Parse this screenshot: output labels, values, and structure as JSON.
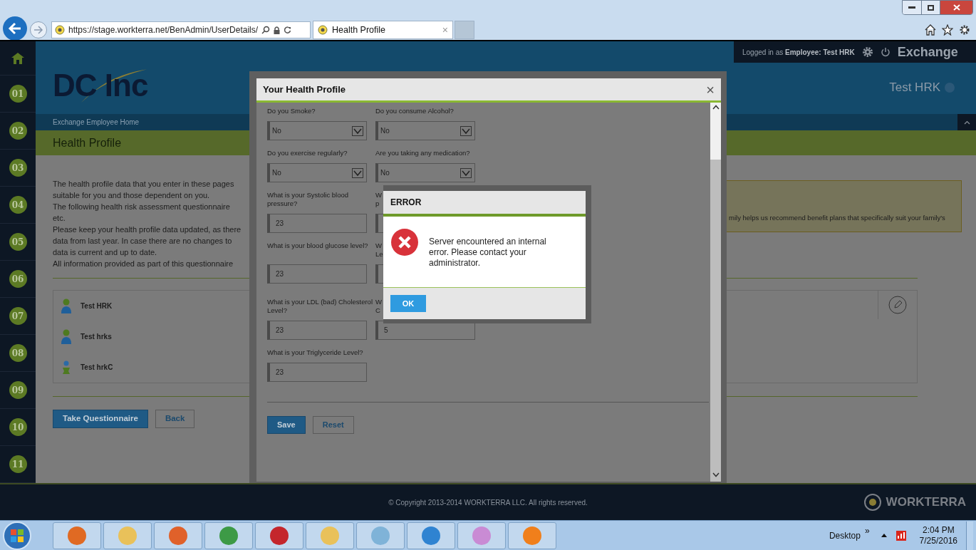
{
  "browser": {
    "url": "https://stage.workterra.net/BenAdmin/UserDetails/",
    "tab": {
      "title": "Health Profile",
      "close": "×"
    }
  },
  "header": {
    "session": "Logged in as **Employee:**  **Test HRK**",
    "app": "Exchange",
    "logo": "DC Inc",
    "user_name": "Test HRK",
    "breadcrumb": "Exchange Employee Home",
    "page_title": "Health Profile"
  },
  "sidebar": {
    "items": [
      "01",
      "02",
      "03",
      "04",
      "05",
      "06",
      "07",
      "08",
      "09",
      "10",
      "11"
    ]
  },
  "intro_lines": [
    "The health profile data that you enter in these pages",
    "suitable for you and those dependent on you.",
    "The following health risk assessment questionnaire",
    "etc.",
    "Please keep your health profile data updated, as there",
    "data from last year. In case there are no changes to",
    "data is current and up to date.",
    "All information provided as part of this questionnaire"
  ],
  "notice": "mily helps us recommend benefit plans that specifically suit your family's",
  "members": [
    {
      "name": "Test HRK",
      "kind": "employee"
    },
    {
      "name": "Test hrks",
      "kind": "spouse"
    },
    {
      "name": "Test hrkC",
      "kind": "child"
    }
  ],
  "buttons": [
    {
      "label": "Take Questionnaire",
      "kind": "primary"
    },
    {
      "label": "Back",
      "kind": "secondary"
    }
  ],
  "modal": {
    "title": "Your Health Profile",
    "close": "×",
    "rows": [
      [
        {
          "label": "Do you Smoke?",
          "kind": "select",
          "value": "No"
        },
        {
          "label": "Do you consume Alcohol?",
          "kind": "select",
          "value": "No"
        }
      ],
      [
        {
          "label": "Do you exercise regularly?",
          "kind": "select",
          "value": "No"
        },
        {
          "label": "Are you taking any medication?",
          "kind": "select",
          "value": "No"
        }
      ],
      [
        {
          "label": "What is your Systolic blood pressure?",
          "kind": "text",
          "value": "23"
        },
        {
          "label": "W\np",
          "kind": "text"
        }
      ],
      [
        {
          "label": "What is your blood glucose level?",
          "kind": "text",
          "value": "23"
        },
        {
          "label": "W\nLe",
          "kind": "text"
        }
      ],
      [
        {
          "label": "What is your LDL (bad) Cholesterol Level?",
          "kind": "text",
          "value": "23"
        },
        {
          "label": "W\nC",
          "kind": "text",
          "value": "5"
        }
      ],
      [
        {
          "label": "What is your Triglyceride Level?",
          "kind": "text",
          "value": "23"
        }
      ]
    ],
    "buttons": [
      {
        "label": "Save",
        "kind": "primary"
      },
      {
        "label": "Reset",
        "kind": "secondary"
      }
    ]
  },
  "error": {
    "title": "ERROR",
    "message": "Server encountered an internal error. Please contact your administrator.",
    "button": "OK"
  },
  "footer": {
    "copyright": "© Copyright 2013-2014 WORKTERRA LLC. All rights reserved.",
    "brand": "WORKTERRA"
  },
  "taskbar": {
    "desktop": "Desktop",
    "overflow": "»",
    "time": "2:04 PM",
    "date": "7/25/2016"
  }
}
